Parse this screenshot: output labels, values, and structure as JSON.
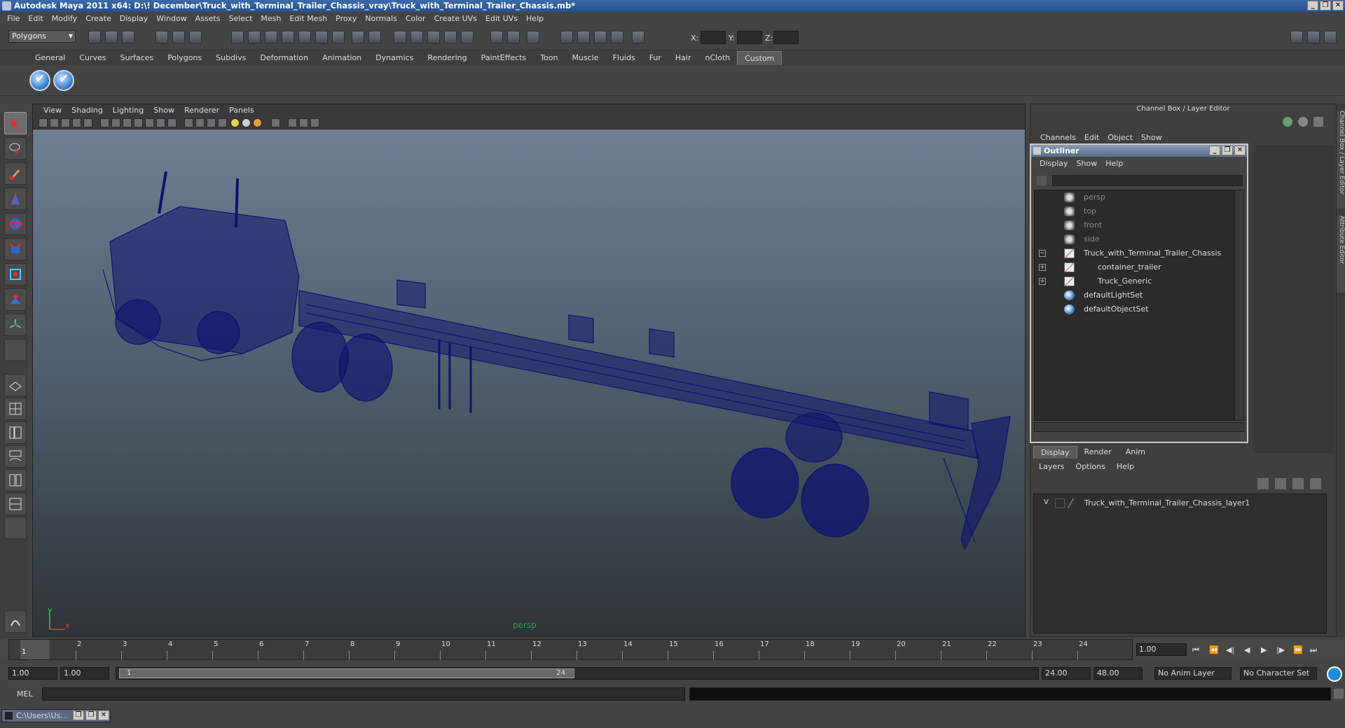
{
  "window": {
    "title": "Autodesk Maya 2011 x64: D:\\! December\\Truck_with_Terminal_Trailer_Chassis_vray\\Truck_with_Terminal_Trailer_Chassis.mb*",
    "controls": [
      "_",
      "❐",
      "✕"
    ]
  },
  "menubar": [
    "File",
    "Edit",
    "Modify",
    "Create",
    "Display",
    "Window",
    "Assets",
    "Select",
    "Mesh",
    "Edit Mesh",
    "Proxy",
    "Normals",
    "Color",
    "Create UVs",
    "Edit UVs",
    "Help"
  ],
  "statusline": {
    "mode": "Polygons",
    "coord_labels": [
      "X:",
      "Y:",
      "Z:"
    ]
  },
  "shelf_tabs": [
    "General",
    "Curves",
    "Surfaces",
    "Polygons",
    "Subdivs",
    "Deformation",
    "Animation",
    "Dynamics",
    "Rendering",
    "PaintEffects",
    "Toon",
    "Muscle",
    "Fluids",
    "Fur",
    "Hair",
    "nCloth",
    "Custom"
  ],
  "shelf_active_tab": "Custom",
  "viewport": {
    "menus": [
      "View",
      "Shading",
      "Lighting",
      "Show",
      "Renderer",
      "Panels"
    ],
    "camera_label": "persp",
    "axis_y": "y",
    "axis_x": "x",
    "wire_color": "#0e1370"
  },
  "channel_box": {
    "title": "Channel Box / Layer Editor",
    "menus": [
      "Channels",
      "Edit",
      "Object",
      "Show"
    ]
  },
  "side_tabs": [
    "Channel Box / Layer Editor",
    "Attribute Editor"
  ],
  "outliner": {
    "title": "Outliner",
    "menus": [
      "Display",
      "Show",
      "Help"
    ],
    "items": [
      {
        "label": "persp",
        "icon": "camera-icon",
        "dim": true,
        "indent": 0,
        "expand": ""
      },
      {
        "label": "top",
        "icon": "camera-icon",
        "dim": true,
        "indent": 0,
        "expand": ""
      },
      {
        "label": "front",
        "icon": "camera-icon",
        "dim": true,
        "indent": 0,
        "expand": ""
      },
      {
        "label": "side",
        "icon": "camera-icon",
        "dim": true,
        "indent": 0,
        "expand": ""
      },
      {
        "label": "Truck_with_Terminal_Trailer_Chassis",
        "icon": "group-icon",
        "dim": false,
        "indent": 0,
        "expand": "−"
      },
      {
        "label": "container_trailer",
        "icon": "group-icon",
        "dim": false,
        "indent": 1,
        "expand": "+"
      },
      {
        "label": "Truck_Generic",
        "icon": "group-icon",
        "dim": false,
        "indent": 1,
        "expand": "+"
      },
      {
        "label": "defaultLightSet",
        "icon": "set-icon",
        "dim": false,
        "indent": 0,
        "expand": ""
      },
      {
        "label": "defaultObjectSet",
        "icon": "set-icon",
        "dim": false,
        "indent": 0,
        "expand": ""
      }
    ]
  },
  "layer_editor": {
    "tabs": [
      "Display",
      "Render",
      "Anim"
    ],
    "active_tab": "Display",
    "menus": [
      "Layers",
      "Options",
      "Help"
    ],
    "layers": [
      {
        "visible": "V",
        "name": "Truck_with_Terminal_Trailer_Chassis_layer1"
      }
    ]
  },
  "timeline": {
    "ticks": [
      1,
      2,
      3,
      4,
      5,
      6,
      7,
      8,
      9,
      10,
      11,
      12,
      13,
      14,
      15,
      16,
      17,
      18,
      19,
      20,
      21,
      22,
      23,
      24
    ],
    "current_frame_marker": "1",
    "current_time": "1.00",
    "playback_buttons": [
      "⏮",
      "⏪",
      "◀|",
      "◀",
      "▶",
      "|▶",
      "⏩",
      "⏭"
    ]
  },
  "range": {
    "start": "1.00",
    "playback_start": "1.00",
    "range_start_label": "1",
    "range_end_label": "24",
    "playback_end": "24.00",
    "end": "48.00",
    "anim_layer": "No Anim Layer",
    "character_set": "No Character Set"
  },
  "command_line": {
    "label": "MEL",
    "value": ""
  },
  "taskbar": {
    "item": "C:\\Users\\Us..."
  }
}
